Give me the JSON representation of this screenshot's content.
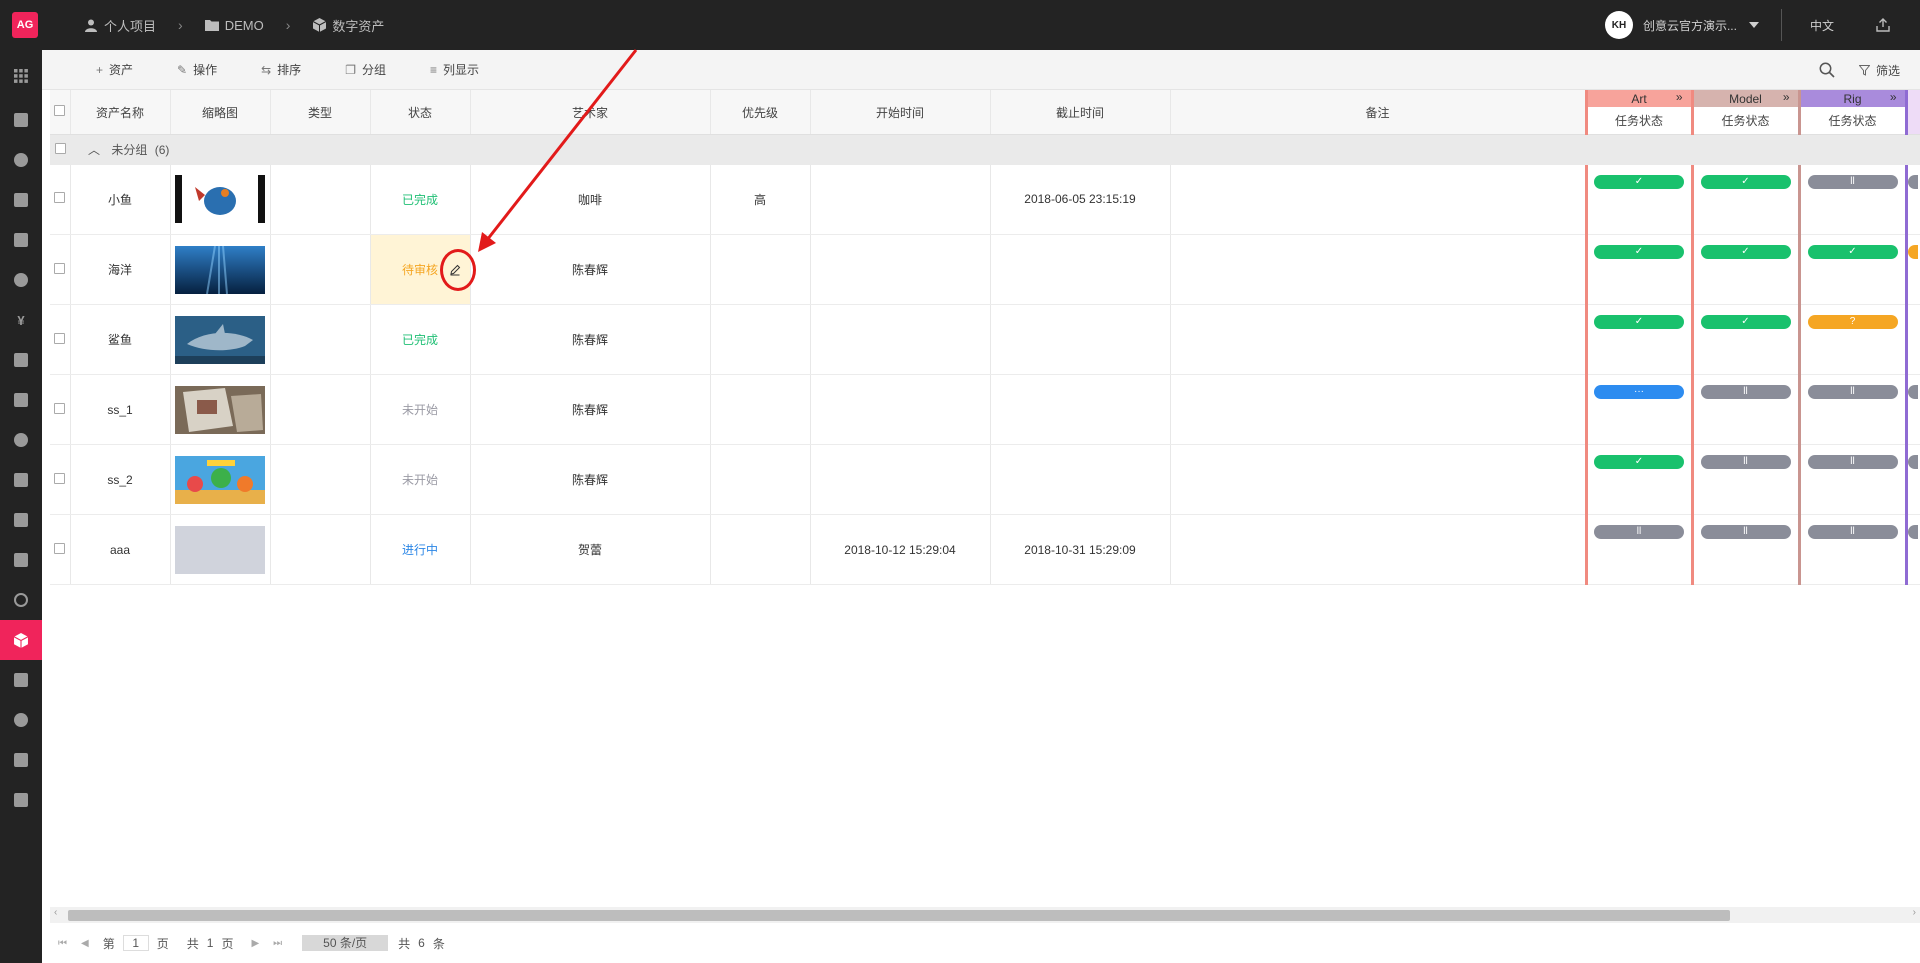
{
  "app": {
    "logo": "AG"
  },
  "breadcrumb": [
    {
      "label": "个人项目",
      "icon": "user-icon"
    },
    {
      "label": "DEMO",
      "icon": "folder-icon"
    },
    {
      "label": "数字资产",
      "icon": "cube-icon"
    }
  ],
  "user": {
    "avatar_text": "KH",
    "name": "创意云官方演示..."
  },
  "lang": "中文",
  "toolbar": {
    "asset": "资产",
    "operate": "操作",
    "sort": "排序",
    "group": "分组",
    "columns": "列显示",
    "filter": "筛选"
  },
  "table": {
    "headers": {
      "name": "资产名称",
      "thumb": "缩略图",
      "type": "类型",
      "status": "状态",
      "artist": "艺术家",
      "priority": "优先级",
      "start": "开始时间",
      "end": "截止时间",
      "note": "备注"
    },
    "tasks": [
      {
        "name": "Art",
        "sub": "任务状态",
        "color": "#f7a39b",
        "border": "#f08a80"
      },
      {
        "name": "Model",
        "sub": "任务状态",
        "color": "#d6b3ae",
        "border": "#c99590"
      },
      {
        "name": "Rig",
        "sub": "任务状态",
        "color": "#a98bdc",
        "border": "#8f6bd3"
      }
    ],
    "group": {
      "label": "未分组",
      "count": "(6)"
    },
    "rows": [
      {
        "name": "小鱼",
        "status": "已完成",
        "status_type": "done",
        "artist": "咖啡",
        "priority": "高",
        "start": "",
        "end": "2018-06-05 23:15:19",
        "tasks": [
          "done",
          "done",
          "paused"
        ]
      },
      {
        "name": "海洋",
        "status": "待审核",
        "status_type": "review",
        "artist": "陈春辉",
        "priority": "",
        "start": "",
        "end": "",
        "tasks": [
          "done",
          "done",
          "done"
        ]
      },
      {
        "name": "鲨鱼",
        "status": "已完成",
        "status_type": "done",
        "artist": "陈春辉",
        "priority": "",
        "start": "",
        "end": "",
        "tasks": [
          "done",
          "done",
          "question"
        ]
      },
      {
        "name": "ss_1",
        "status": "未开始",
        "status_type": "notstart",
        "artist": "陈春辉",
        "priority": "",
        "start": "",
        "end": "",
        "tasks": [
          "running",
          "paused",
          "paused"
        ]
      },
      {
        "name": "ss_2",
        "status": "未开始",
        "status_type": "notstart",
        "artist": "陈春辉",
        "priority": "",
        "start": "",
        "end": "",
        "tasks": [
          "done",
          "paused",
          "paused"
        ]
      },
      {
        "name": "aaa",
        "status": "进行中",
        "status_type": "progress",
        "artist": "贺蕾",
        "priority": "",
        "start": "2018-10-12 15:29:04",
        "end": "2018-10-31 15:29:09",
        "tasks": [
          "paused",
          "paused",
          "paused"
        ]
      }
    ]
  },
  "pill_glyphs": {
    "done": "✓",
    "paused": "ll",
    "question": "?",
    "running": "···"
  },
  "pager": {
    "page_prefix": "第",
    "page": "1",
    "page_suffix": "页",
    "total_pages_prefix": "共",
    "total_pages": "1",
    "total_pages_suffix": "页",
    "per_page": "50 条/页",
    "total_prefix": "共",
    "total": "6",
    "total_suffix": "条"
  }
}
